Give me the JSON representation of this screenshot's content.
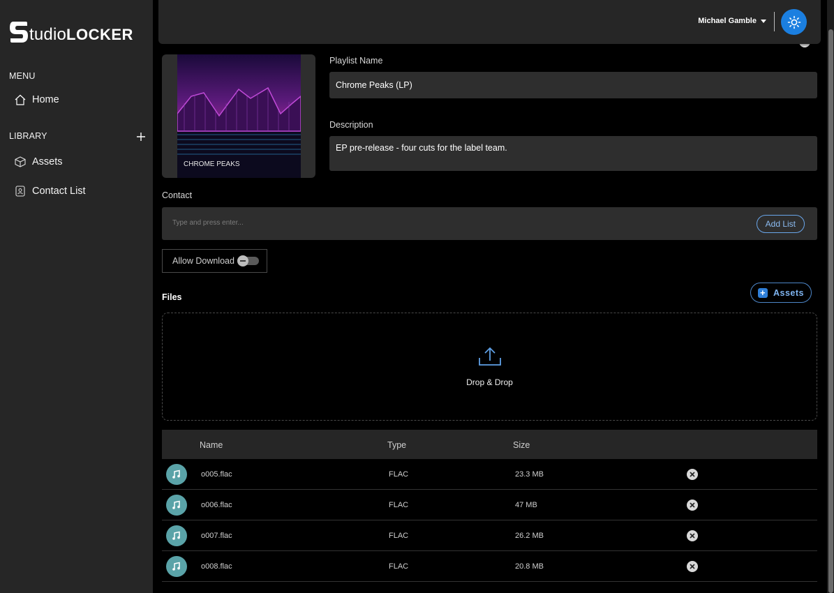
{
  "brand": {
    "logo_text_light": "tudio",
    "logo_text_bold": "LOCKER"
  },
  "sidebar": {
    "menu_title": "MENU",
    "menu_items": [
      {
        "label": "Home",
        "icon": "home-icon"
      }
    ],
    "library_title": "LIBRARY",
    "library_items": [
      {
        "label": "Assets",
        "icon": "cube-icon"
      },
      {
        "label": "Contact List",
        "icon": "contact-icon"
      }
    ]
  },
  "header": {
    "user_name": "Michael Gamble",
    "theme_icon": "sun-icon"
  },
  "playlist": {
    "cover_title": "CHROME PEAKS",
    "name_label": "Playlist Name",
    "name_value": "Chrome Peaks (LP)",
    "description_label": "Description",
    "description_value": "EP pre-release - four cuts for the label team."
  },
  "contact": {
    "label": "Contact",
    "placeholder": "Type and press enter...",
    "add_list_label": "Add List"
  },
  "allow_download": {
    "label": "Allow Download",
    "enabled": false
  },
  "files": {
    "title": "Files",
    "assets_button": "Assets",
    "dropzone_text": "Drop & Drop",
    "columns": {
      "name": "Name",
      "type": "Type",
      "size": "Size"
    },
    "rows": [
      {
        "name": "o005.flac",
        "type": "FLAC",
        "size": "23.3 MB"
      },
      {
        "name": "o006.flac",
        "type": "FLAC",
        "size": "47 MB"
      },
      {
        "name": "o007.flac",
        "type": "FLAC",
        "size": "26.2 MB"
      },
      {
        "name": "o008.flac",
        "type": "FLAC",
        "size": "20.8 MB"
      }
    ]
  },
  "colors": {
    "accent": "#1b7fe0",
    "sidebar_bg": "#262626",
    "music_icon_bg": "#5aa3a8"
  }
}
